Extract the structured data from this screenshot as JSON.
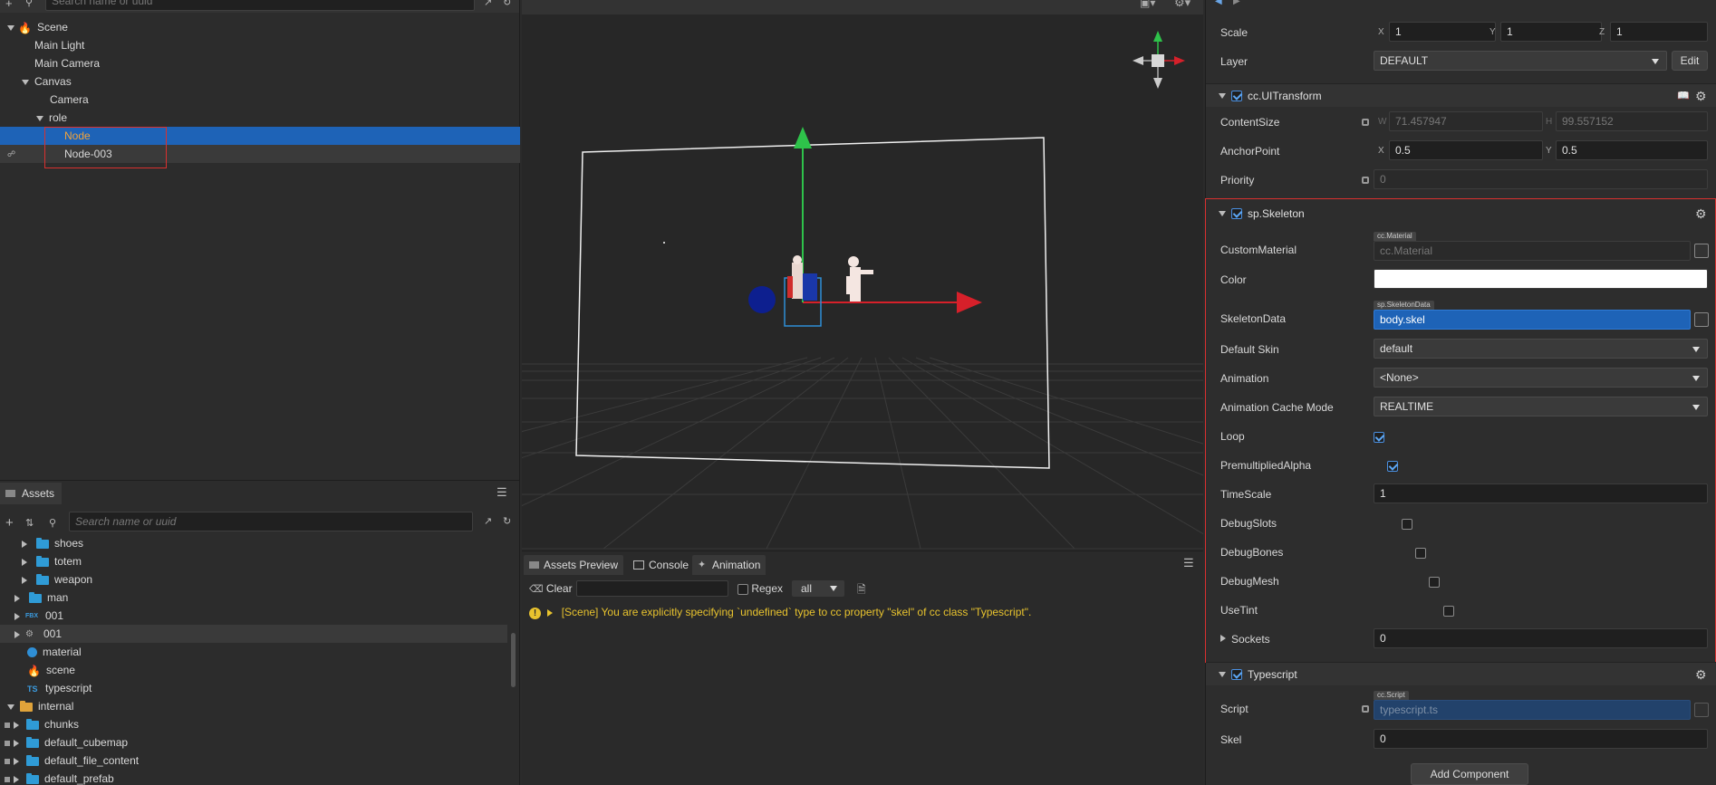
{
  "hierarchy": {
    "search_placeholder": "Search name or uuid",
    "items": [
      {
        "label": "Scene"
      },
      {
        "label": "Main Light"
      },
      {
        "label": "Main Camera"
      },
      {
        "label": "Canvas"
      },
      {
        "label": "Camera"
      },
      {
        "label": "role"
      },
      {
        "label": "Node"
      },
      {
        "label": "Node-003"
      }
    ]
  },
  "assets": {
    "tab_label": "Assets",
    "search_placeholder": "Search name or uuid",
    "items": [
      {
        "label": "shoes"
      },
      {
        "label": "totem"
      },
      {
        "label": "weapon"
      },
      {
        "label": "man"
      },
      {
        "label": "001",
        "badge": "FBX"
      },
      {
        "label": "001"
      },
      {
        "label": "material"
      },
      {
        "label": "scene"
      },
      {
        "label": "typescript",
        "badge": "TS"
      },
      {
        "label": "internal"
      },
      {
        "label": "chunks"
      },
      {
        "label": "default_cubemap"
      },
      {
        "label": "default_file_content"
      },
      {
        "label": "default_prefab"
      }
    ]
  },
  "console": {
    "tabs": [
      "Assets Preview",
      "Console",
      "Animation"
    ],
    "clear_label": "Clear",
    "regex_label": "Regex",
    "filter_value": "all",
    "message": "[Scene] You are explicitly specifying `undefined` type to cc property \"skel\" of cc class \"Typescript\"."
  },
  "inspector": {
    "scale": {
      "label": "Scale",
      "x": "1",
      "y": "1",
      "z": "1"
    },
    "layer": {
      "label": "Layer",
      "value": "DEFAULT",
      "edit_label": "Edit"
    },
    "uitransform": {
      "title": "cc.UITransform",
      "content_size_label": "ContentSize",
      "width_axis": "W",
      "width": "71.457947",
      "height_axis": "H",
      "height": "99.557152",
      "anchor_label": "AnchorPoint",
      "anchor_x": "0.5",
      "anchor_y": "0.5",
      "priority_label": "Priority",
      "priority": "0"
    },
    "skeleton": {
      "title": "sp.Skeleton",
      "custom_material_label": "CustomMaterial",
      "custom_material_tag": "cc.Material",
      "custom_material_value": "cc.Material",
      "color_label": "Color",
      "color_value": "#ffffff",
      "skeleton_data_label": "SkeletonData",
      "skeleton_data_tag": "sp.SkeletonData",
      "skeleton_data_value": "body.skel",
      "default_skin_label": "Default Skin",
      "default_skin_value": "default",
      "animation_label": "Animation",
      "animation_value": "<None>",
      "cache_mode_label": "Animation Cache Mode",
      "cache_mode_value": "REALTIME",
      "loop_label": "Loop",
      "loop": true,
      "premult_label": "PremultipliedAlpha",
      "premult": true,
      "timescale_label": "TimeScale",
      "timescale": "1",
      "debug_slots_label": "DebugSlots",
      "debug_slots": false,
      "debug_bones_label": "DebugBones",
      "debug_bones": false,
      "debug_mesh_label": "DebugMesh",
      "debug_mesh": false,
      "use_tint_label": "UseTint",
      "use_tint": false,
      "sockets_label": "Sockets",
      "sockets": "0"
    },
    "typescript": {
      "title": "Typescript",
      "script_label": "Script",
      "script_tag": "cc.Script",
      "script_value": "typescript.ts",
      "skel_label": "Skel",
      "skel_value": "0"
    },
    "add_component_label": "Add Component"
  },
  "colors": {
    "selection": "#1e63b7",
    "highlight_box": "#d9302f",
    "warning": "#e8c32e"
  }
}
